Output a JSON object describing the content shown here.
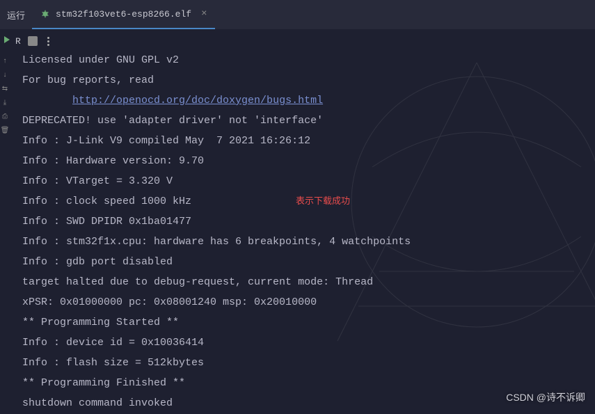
{
  "topnav": {
    "truncated_item": "运行"
  },
  "tab": {
    "filename": "stm32f103vet6-esp8266.elf"
  },
  "toolbar": {
    "run_label": "R"
  },
  "console": {
    "line1": "Licensed under GNU GPL v2",
    "line2": "For bug reports, read",
    "line3_pad": "        ",
    "line3_url": "http://openocd.org/doc/doxygen/bugs.html",
    "line4": "DEPRECATED! use 'adapter driver' not 'interface'",
    "line5": "Info : J-Link V9 compiled May  7 2021 16:26:12",
    "line6": "Info : Hardware version: 9.70",
    "line7": "Info : VTarget = 3.320 V",
    "line8": "Info : clock speed 1000 kHz",
    "line9": "Info : SWD DPIDR 0x1ba01477",
    "line10": "Info : stm32f1x.cpu: hardware has 6 breakpoints, 4 watchpoints",
    "line11": "Info : gdb port disabled",
    "line12": "target halted due to debug-request, current mode: Thread",
    "line13": "xPSR: 0x01000000 pc: 0x08001240 msp: 0x20010000",
    "line14": "** Programming Started **",
    "line15": "Info : device id = 0x10036414",
    "line16": "Info : flash size = 512kbytes",
    "line17": "** Programming Finished **",
    "line18": "shutdown command invoked"
  },
  "annotation": {
    "text": "表示下载成功"
  },
  "watermark": {
    "text": "CSDN @诗不诉卿"
  }
}
